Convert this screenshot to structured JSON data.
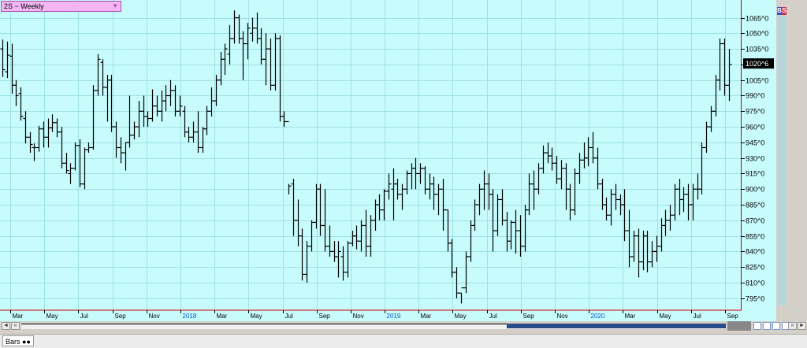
{
  "symbol_label": "2S ~ Weekly",
  "dropdown_arrow": "▼",
  "current_price_label": "1020^6",
  "bs_buttons": {
    "b": "B",
    "s": "S"
  },
  "bottom_tab": "Bars",
  "scroll": {
    "left": "◄",
    "left2": "«",
    "right": "»",
    "right2": "►"
  },
  "y_tick_labels": [
    "1065^0",
    "1050^0",
    "1035^0",
    "1020^0",
    "1005^0",
    "990^0",
    "975^0",
    "960^0",
    "945^0",
    "930^0",
    "915^0",
    "900^0",
    "885^0",
    "870^0",
    "855^0",
    "840^0",
    "825^0",
    "810^0",
    "795^0"
  ],
  "x_tick_labels": [
    "Mar",
    "May",
    "Jul",
    "Sep",
    "Nov",
    "2018",
    "Mar",
    "May",
    "Jul",
    "Sep",
    "Nov",
    "2019",
    "Mar",
    "May",
    "Jul",
    "Sep",
    "Nov",
    "2020",
    "Mar",
    "May",
    "Jul",
    "Sep"
  ],
  "colors": {
    "background": "#c8fcfc",
    "grid": "#9ee0e6",
    "bar": "#000000",
    "year_label": "#0055cc",
    "axis_line": "#cc0000",
    "price_box": "#000000"
  },
  "chart_data": {
    "type": "bar",
    "subtype": "ohlc",
    "grid": true,
    "ylim": [
      785,
      1076
    ],
    "y_ticks": [
      1065,
      1050,
      1035,
      1020,
      1005,
      990,
      975,
      960,
      945,
      930,
      915,
      900,
      885,
      870,
      855,
      840,
      825,
      810,
      795
    ],
    "x_ticks": [
      {
        "label": "Mar",
        "year": false
      },
      {
        "label": "May",
        "year": false
      },
      {
        "label": "Jul",
        "year": false
      },
      {
        "label": "Sep",
        "year": false
      },
      {
        "label": "Nov",
        "year": false
      },
      {
        "label": "2018",
        "year": true
      },
      {
        "label": "Mar",
        "year": false
      },
      {
        "label": "May",
        "year": false
      },
      {
        "label": "Jul",
        "year": false
      },
      {
        "label": "Sep",
        "year": false
      },
      {
        "label": "Nov",
        "year": false
      },
      {
        "label": "2019",
        "year": true
      },
      {
        "label": "Mar",
        "year": false
      },
      {
        "label": "May",
        "year": false
      },
      {
        "label": "Jul",
        "year": false
      },
      {
        "label": "Sep",
        "year": false
      },
      {
        "label": "Nov",
        "year": false
      },
      {
        "label": "2020",
        "year": true
      },
      {
        "label": "Mar",
        "year": false
      },
      {
        "label": "May",
        "year": false
      },
      {
        "label": "Jul",
        "year": false
      },
      {
        "label": "Sep",
        "year": false
      }
    ],
    "last_value": 1020.6,
    "bars": [
      [
        1035,
        1044,
        1008,
        1015
      ],
      [
        1013,
        1042,
        1007,
        1029
      ],
      [
        1028,
        1040,
        992,
        1000
      ],
      [
        1000,
        1005,
        980,
        990
      ],
      [
        992,
        998,
        966,
        970
      ],
      [
        968,
        975,
        944,
        950
      ],
      [
        950,
        955,
        935,
        943
      ],
      [
        940,
        944,
        927,
        940
      ],
      [
        940,
        961,
        936,
        958
      ],
      [
        958,
        965,
        940,
        950
      ],
      [
        950,
        968,
        940,
        959
      ],
      [
        959,
        972,
        955,
        964
      ],
      [
        964,
        968,
        950,
        955
      ],
      [
        955,
        960,
        920,
        925
      ],
      [
        925,
        935,
        915,
        918
      ],
      [
        915,
        925,
        905,
        920
      ],
      [
        920,
        945,
        918,
        942
      ],
      [
        942,
        948,
        902,
        905
      ],
      [
        905,
        940,
        900,
        938
      ],
      [
        938,
        945,
        935,
        940
      ],
      [
        940,
        1000,
        938,
        995
      ],
      [
        995,
        1030,
        990,
        1025
      ],
      [
        1022,
        1025,
        990,
        998
      ],
      [
        998,
        1010,
        965,
        1005
      ],
      [
        1005,
        1010,
        955,
        960
      ],
      [
        960,
        965,
        930,
        940
      ],
      [
        940,
        950,
        925,
        935
      ],
      [
        935,
        945,
        918,
        945
      ],
      [
        945,
        990,
        940,
        952
      ],
      [
        952,
        965,
        948,
        960
      ],
      [
        960,
        985,
        950,
        975
      ],
      [
        975,
        990,
        960,
        970
      ],
      [
        970,
        975,
        960,
        968
      ],
      [
        968,
        996,
        965,
        980
      ],
      [
        980,
        990,
        970,
        975
      ],
      [
        975,
        995,
        965,
        985
      ],
      [
        985,
        1000,
        975,
        990
      ],
      [
        990,
        1005,
        980,
        995
      ],
      [
        995,
        1000,
        970,
        975
      ],
      [
        975,
        990,
        970,
        980
      ],
      [
        975,
        980,
        950,
        955
      ],
      [
        955,
        960,
        945,
        950
      ],
      [
        950,
        965,
        945,
        955
      ],
      [
        955,
        975,
        935,
        940
      ],
      [
        940,
        960,
        935,
        958
      ],
      [
        958,
        980,
        952,
        975
      ],
      [
        975,
        998,
        970,
        985
      ],
      [
        985,
        1010,
        980,
        1005
      ],
      [
        1005,
        1032,
        1000,
        1025
      ],
      [
        1025,
        1040,
        1010,
        1035
      ],
      [
        1030,
        1058,
        1020,
        1045
      ],
      [
        1045,
        1072,
        1040,
        1065
      ],
      [
        1065,
        1068,
        1040,
        1045
      ],
      [
        1045,
        1052,
        1005,
        1040
      ],
      [
        1040,
        1060,
        1025,
        1055
      ],
      [
        1050,
        1065,
        1042,
        1055
      ],
      [
        1055,
        1070,
        1040,
        1045
      ],
      [
        1045,
        1055,
        1020,
        1025
      ],
      [
        1025,
        1050,
        1000,
        1035
      ],
      [
        1035,
        1045,
        995,
        1000
      ],
      [
        1000,
        1050,
        995,
        1045
      ],
      [
        1045,
        1048,
        965,
        970
      ],
      [
        970,
        975,
        960,
        965
      ],
      [
        965,
        905,
        895,
        903
      ],
      [
        905,
        910,
        855,
        870
      ],
      [
        870,
        890,
        845,
        855
      ],
      [
        855,
        862,
        812,
        818
      ],
      [
        818,
        850,
        810,
        845
      ],
      [
        845,
        870,
        840,
        868
      ],
      [
        868,
        905,
        862,
        900
      ],
      [
        900,
        905,
        855,
        865
      ],
      [
        865,
        900,
        840,
        845
      ],
      [
        845,
        865,
        835,
        840
      ],
      [
        840,
        850,
        830,
        835
      ],
      [
        835,
        850,
        815,
        840
      ],
      [
        835,
        845,
        812,
        820
      ],
      [
        820,
        850,
        815,
        848
      ],
      [
        848,
        860,
        845,
        855
      ],
      [
        855,
        865,
        842,
        850
      ],
      [
        850,
        870,
        840,
        865
      ],
      [
        865,
        880,
        835,
        845
      ],
      [
        845,
        875,
        835,
        870
      ],
      [
        870,
        890,
        860,
        885
      ],
      [
        885,
        895,
        870,
        880
      ],
      [
        880,
        900,
        870,
        898
      ],
      [
        898,
        915,
        890,
        905
      ],
      [
        900,
        920,
        870,
        905
      ],
      [
        905,
        910,
        890,
        895
      ],
      [
        895,
        905,
        880,
        900
      ],
      [
        900,
        918,
        895,
        915
      ],
      [
        915,
        925,
        900,
        920
      ],
      [
        920,
        930,
        900,
        915
      ],
      [
        915,
        925,
        905,
        920
      ],
      [
        920,
        922,
        895,
        900
      ],
      [
        900,
        915,
        890,
        905
      ],
      [
        905,
        912,
        880,
        895
      ],
      [
        895,
        905,
        875,
        900
      ],
      [
        900,
        910,
        860,
        880
      ],
      [
        880,
        880,
        840,
        848
      ],
      [
        848,
        852,
        815,
        820
      ],
      [
        820,
        825,
        795,
        800
      ],
      [
        800,
        800,
        790,
        805
      ],
      [
        805,
        840,
        800,
        835
      ],
      [
        835,
        870,
        830,
        865
      ],
      [
        865,
        890,
        860,
        885
      ],
      [
        885,
        905,
        875,
        900
      ],
      [
        900,
        918,
        880,
        905
      ],
      [
        905,
        915,
        880,
        895
      ],
      [
        895,
        900,
        840,
        860
      ],
      [
        860,
        895,
        855,
        890
      ],
      [
        890,
        900,
        865,
        870
      ],
      [
        870,
        878,
        840,
        850
      ],
      [
        850,
        870,
        842,
        868
      ],
      [
        868,
        880,
        838,
        860
      ],
      [
        860,
        875,
        835,
        845
      ],
      [
        845,
        885,
        840,
        880
      ],
      [
        880,
        915,
        875,
        905
      ],
      [
        905,
        918,
        880,
        900
      ],
      [
        900,
        925,
        895,
        920
      ],
      [
        920,
        942,
        915,
        935
      ],
      [
        935,
        945,
        925,
        932
      ],
      [
        932,
        940,
        918,
        925
      ],
      [
        925,
        932,
        905,
        910
      ],
      [
        910,
        928,
        900,
        920
      ],
      [
        920,
        925,
        880,
        900
      ],
      [
        900,
        905,
        870,
        880
      ],
      [
        880,
        920,
        875,
        915
      ],
      [
        915,
        935,
        905,
        928
      ],
      [
        928,
        945,
        920,
        930
      ],
      [
        930,
        950,
        922,
        940
      ],
      [
        940,
        955,
        925,
        930
      ],
      [
        930,
        940,
        900,
        905
      ],
      [
        905,
        910,
        880,
        885
      ],
      [
        885,
        892,
        870,
        875
      ],
      [
        875,
        900,
        865,
        895
      ],
      [
        895,
        905,
        880,
        890
      ],
      [
        890,
        895,
        875,
        885
      ],
      [
        885,
        900,
        850,
        860
      ],
      [
        860,
        880,
        825,
        835
      ],
      [
        835,
        860,
        830,
        855
      ],
      [
        855,
        862,
        815,
        830
      ],
      [
        830,
        860,
        822,
        855
      ],
      [
        855,
        860,
        820,
        830
      ],
      [
        830,
        850,
        825,
        840
      ],
      [
        840,
        855,
        830,
        845
      ],
      [
        845,
        872,
        840,
        865
      ],
      [
        865,
        880,
        855,
        870
      ],
      [
        870,
        885,
        860,
        875
      ],
      [
        875,
        905,
        870,
        900
      ],
      [
        900,
        910,
        875,
        890
      ],
      [
        890,
        902,
        878,
        895
      ],
      [
        895,
        905,
        870,
        885
      ],
      [
        885,
        905,
        870,
        900
      ],
      [
        900,
        915,
        890,
        900
      ],
      [
        900,
        945,
        895,
        940
      ],
      [
        940,
        965,
        935,
        960
      ],
      [
        960,
        980,
        955,
        975
      ],
      [
        975,
        1010,
        970,
        1005
      ],
      [
        1005,
        1045,
        995,
        1040
      ],
      [
        1040,
        1045,
        990,
        1000
      ],
      [
        1000,
        1035,
        985,
        1020
      ]
    ]
  }
}
